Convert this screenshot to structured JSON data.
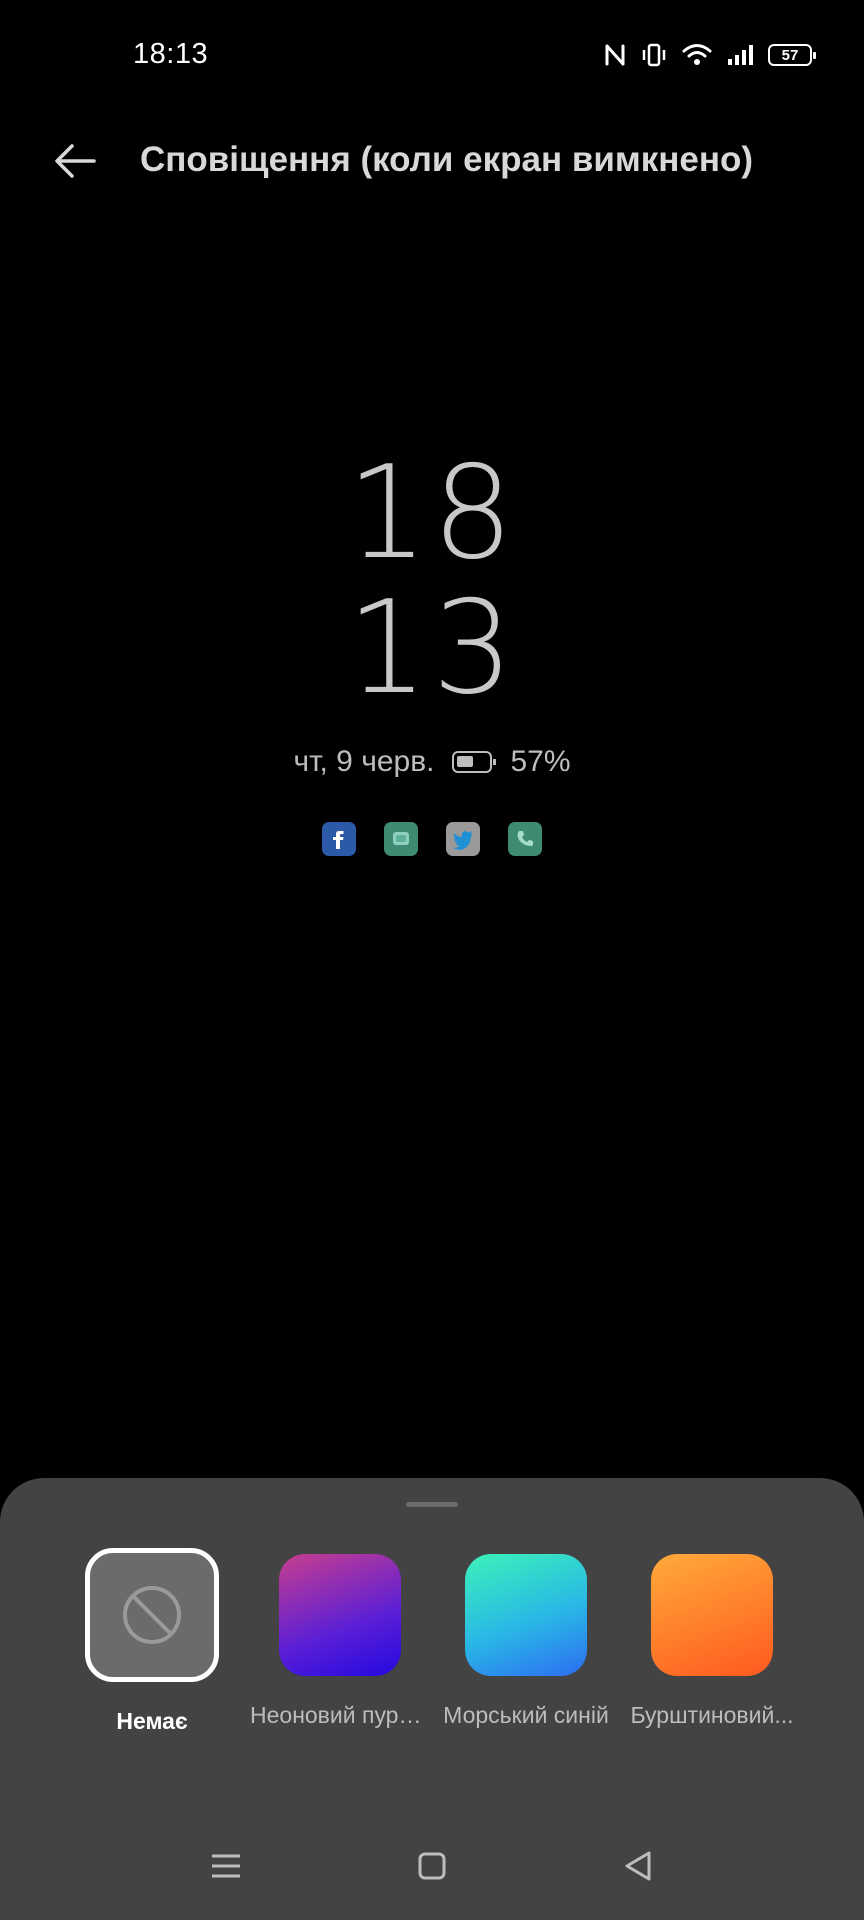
{
  "status_bar": {
    "time": "18:13",
    "battery_level": "57",
    "icons": [
      "nfc-icon",
      "vibrate-icon",
      "wifi-icon",
      "signal-icon",
      "battery-icon"
    ]
  },
  "header": {
    "back_icon": "back-arrow-icon",
    "title": "Сповіщення (коли екран вимкнено)"
  },
  "aod_preview": {
    "hour": "18",
    "minute": "13",
    "date": "чт, 9 черв.",
    "battery_percent": "57%",
    "notification_icons": [
      "facebook-icon",
      "messages-icon",
      "twitter-icon",
      "phone-icon"
    ]
  },
  "theme_picker": {
    "selected_index": 0,
    "themes": [
      {
        "label": "Немає",
        "swatch": "none"
      },
      {
        "label": "Неоновий пурпуровий",
        "display_label": "Неоновий пурп...",
        "swatch_colors": [
          "#c83e8e",
          "#5a1fd6",
          "#2408e0"
        ]
      },
      {
        "label": "Морський синій",
        "display_label": "Морський синій",
        "swatch_colors": [
          "#3cf2b8",
          "#29b8e6",
          "#2d6df2"
        ]
      },
      {
        "label": "Бурштиновий",
        "display_label": "Бурштиновий...",
        "swatch_colors": [
          "#ffaa3a",
          "#ff7a2a",
          "#ff5a1f"
        ]
      }
    ]
  },
  "nav_bar": {
    "buttons": [
      "menu-icon",
      "home-icon",
      "back-icon"
    ]
  },
  "colors": {
    "background": "#000000",
    "sheet": "#434343",
    "clock_text": "#c8c8c8"
  }
}
